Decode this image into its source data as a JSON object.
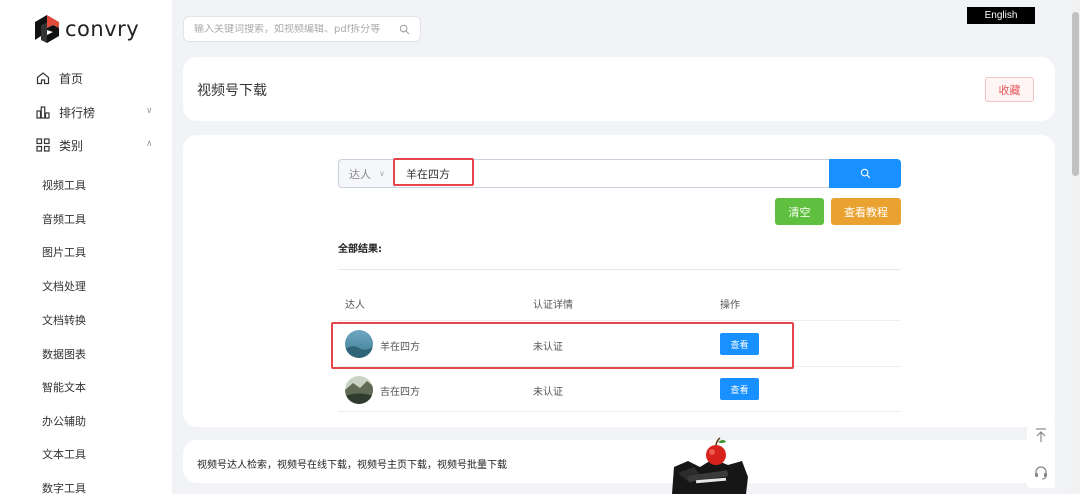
{
  "brand": {
    "name": "convry"
  },
  "top": {
    "search_placeholder": "输入关键词搜索，如视频编辑、pdf拆分等",
    "language_button": "English"
  },
  "sidebar": {
    "nav": [
      {
        "label": "首页",
        "icon": "home-icon"
      },
      {
        "label": "排行榜",
        "icon": "bar-chart-icon"
      },
      {
        "label": "类别",
        "icon": "grid-icon"
      }
    ],
    "categories": [
      "视频工具",
      "音频工具",
      "图片工具",
      "文档处理",
      "文档转换",
      "数据图表",
      "智能文本",
      "办公辅助",
      "文本工具",
      "数字工具"
    ]
  },
  "page": {
    "title": "视频号下载",
    "favorite_button": "收藏"
  },
  "search": {
    "type_selected": "达人",
    "keyword": "羊在四方",
    "clear_button": "清空",
    "tutorial_button": "查看教程"
  },
  "results": {
    "label": "全部结果:",
    "columns": [
      "达人",
      "认证详情",
      "操作"
    ],
    "rows": [
      {
        "name": "羊在四方",
        "verification": "未认证",
        "action": "查看"
      },
      {
        "name": "吉在四方",
        "verification": "未认证",
        "action": "查看"
      }
    ]
  },
  "footer": {
    "description": "视频号达人检索，视频号在线下载，视频号主页下载，视频号批量下载"
  },
  "colors": {
    "primary": "#1890ff",
    "success": "#5ec03e",
    "warning": "#e9a230",
    "highlight": "#e5454b"
  }
}
